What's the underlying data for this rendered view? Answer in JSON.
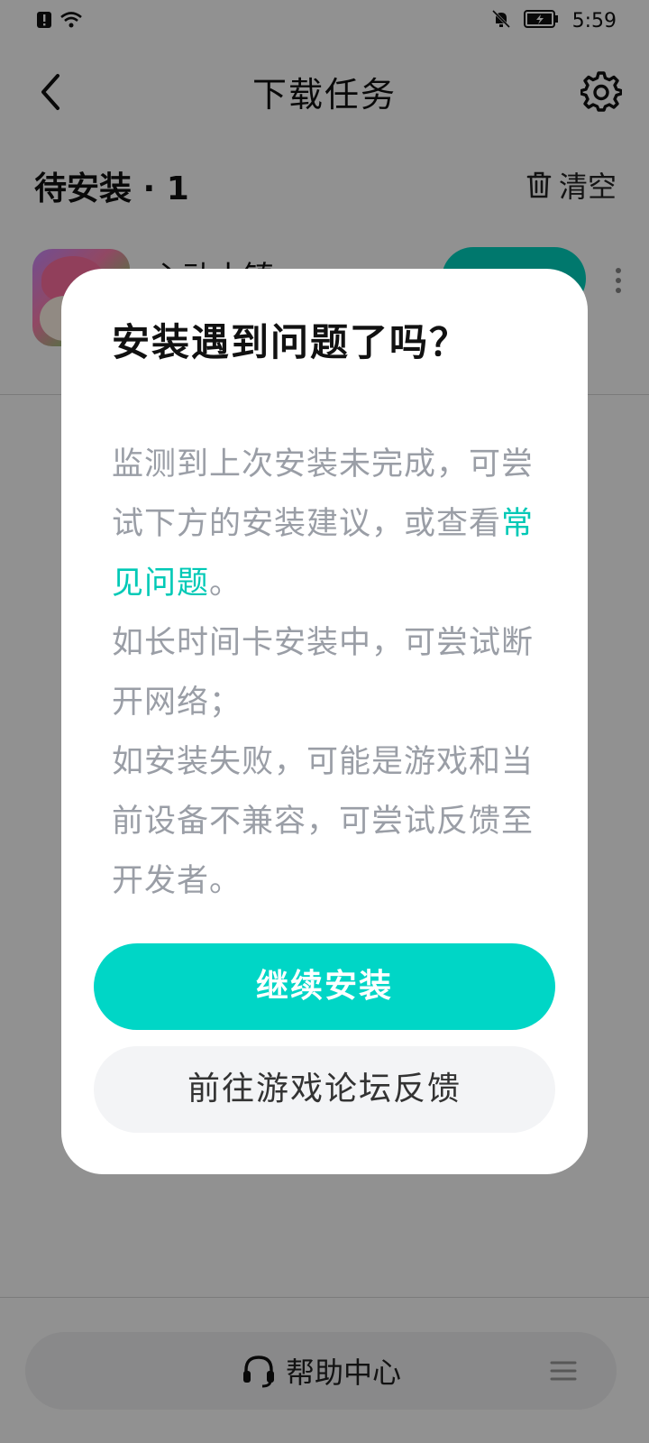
{
  "status_bar": {
    "time": "5:59",
    "icons": [
      "alert-icon",
      "wifi-icon",
      "bell-off-icon",
      "battery-charging-icon"
    ]
  },
  "header": {
    "title": "下载任务",
    "back_icon": "chevron-left-icon",
    "settings_icon": "gear-icon"
  },
  "section": {
    "title": "待安装 · 1",
    "clear_label": "清空",
    "clear_icon": "trash-icon"
  },
  "app_item": {
    "name": "心动小镇",
    "button_label": "",
    "more_icon": "more-vertical-icon"
  },
  "bottom": {
    "help_label": "帮助中心",
    "help_icon": "headset-icon",
    "menu_icon": "menu-icon"
  },
  "dialog": {
    "title": "安装遇到问题了吗？",
    "body_part1": "监测到上次安装未完成，可尝试下方的安装建议，或查看",
    "faq_link": "常见问题",
    "body_part2": "。",
    "line_long_install": "如长时间卡安装中，可尝试断开网络；",
    "line_failed": "如安装失败，可能是游戏和当前设备不兼容，可尝试反馈至开发者。",
    "primary_button": "继续安装",
    "secondary_button": "前往游戏论坛反馈"
  },
  "colors": {
    "accent": "#00d6c6",
    "link": "#00c9b6",
    "overlay": "rgba(0,0,0,0.43)",
    "body_text": "#9a9ea6"
  }
}
